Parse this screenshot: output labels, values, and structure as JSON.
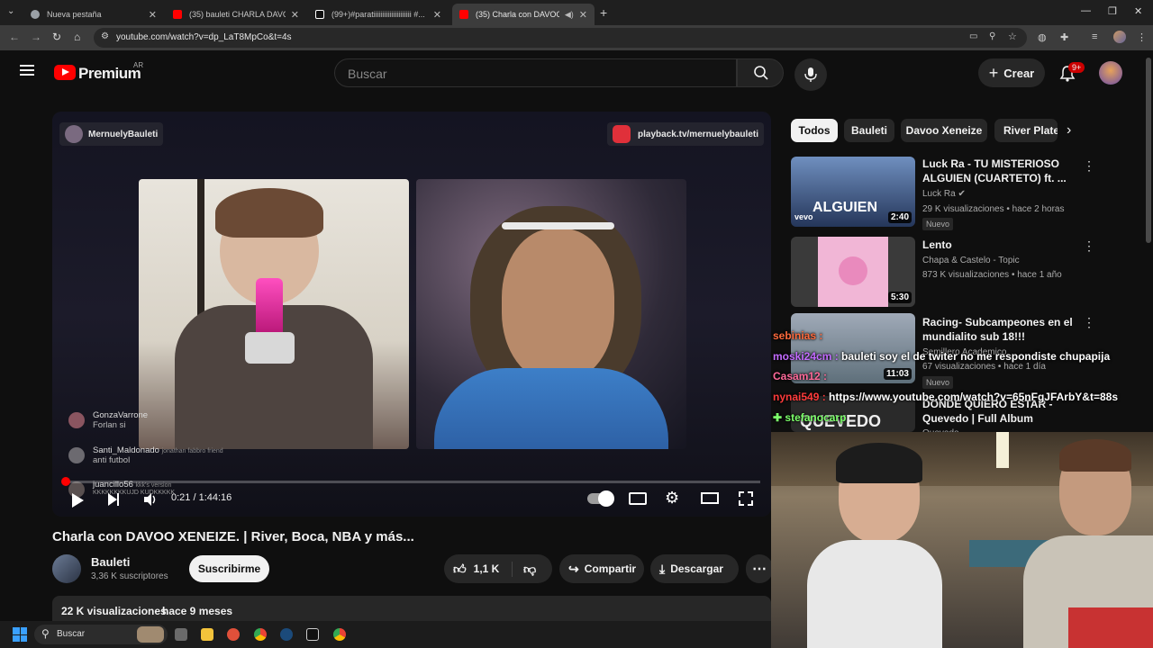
{
  "browser": {
    "tabs": [
      {
        "title": "Nueva pestaña",
        "active": false,
        "favicon_color": "#9aa0a6"
      },
      {
        "title": "(35) bauleti CHARLA DAVO XE...",
        "active": false,
        "favicon_color": "#ff0000"
      },
      {
        "title": "(99+)#paratiiiiiiiiiiiiiiiiiiiii #...",
        "active": false,
        "favicon_color": "#ffffff"
      },
      {
        "title": "(35) Charla con DAVOO XE...",
        "active": true,
        "favicon_color": "#ff0000"
      }
    ],
    "new_tab": "+",
    "url": "youtube.com/watch?v=dp_LaT8MpCo&t=4s"
  },
  "header": {
    "logo_text": "Premium",
    "region": "AR",
    "search_placeholder": "Buscar",
    "create_label": "Crear",
    "notifications_badge": "9+"
  },
  "player": {
    "channel_badge": "MernuelyBauleti",
    "playback_badge": "playback.tv/mernuelybauleti",
    "time": "0:21 / 1:44:16",
    "progress_fraction": 0.0034,
    "chat": [
      {
        "user": "GonzaVarrone",
        "msg": "Forlan si"
      },
      {
        "user": "Santi_Maldonado",
        "tag": "jonathan fabbro friend",
        "msg": "anti futbol"
      },
      {
        "user": "juancillo56",
        "tag": "kkk's version",
        "msg": "KKKKKKKKUJD KUDKKKKK"
      }
    ]
  },
  "video": {
    "title": "Charla con DAVOO XENEIZE. | River, Boca, NBA y más...",
    "channel": "Bauleti",
    "subscribers": "3,36 K suscriptores",
    "subscribe_label": "Suscribirme",
    "likes": "1,1 K",
    "share_label": "Compartir",
    "download_label": "Descargar",
    "views": "22 K visualizaciones",
    "age": "hace 9 meses"
  },
  "chips": [
    "Todos",
    "Bauleti",
    "Davoo Xeneize",
    "River Plate"
  ],
  "recommendations": [
    {
      "title": "Luck Ra - TU MISTERIOSO ALGUIEN (CUARTETO) ft. ...",
      "channel": "Luck Ra",
      "meta": "29 K visualizaciones • hace 2 horas",
      "badge": "Nuevo",
      "duration": "2:40",
      "thumb_text": "ALGUIEN",
      "thumb_brand": "vevo"
    },
    {
      "title": "Lento",
      "channel": "Chapa & Castelo - Topic",
      "meta": "873 K visualizaciones • hace 1 año",
      "badge": "",
      "duration": "5:30"
    },
    {
      "title": "Racing- Subcampeones en el mundialito sub 18!!!",
      "channel": "Semillero Academico",
      "meta": "67 visualizaciones • hace 1 día",
      "badge": "Nuevo",
      "duration": "11:03"
    },
    {
      "title": "DONDE QUIERO ESTAR - Quevedo | Full Album",
      "channel": "Quevedo",
      "meta": "",
      "badge": "",
      "duration": "",
      "thumb_text": "QUEVEDO"
    }
  ],
  "stream_overlay": [
    {
      "user": "sebinias :",
      "msg": "",
      "color": "#ff6a3c"
    },
    {
      "user": "moski24cm :",
      "msg": "bauleti soy el de twiter no me respondiste chupapija",
      "color": "#c36bff"
    },
    {
      "user": "Casam12 :",
      "msg": "",
      "color": "#ff6a9a"
    },
    {
      "user": "nynai549 :",
      "msg": "https://www.youtube.com/watch?v=65nFgJFArbY&t=88s",
      "color": "#ff3b3b"
    },
    {
      "user": "stefanocarp",
      "msg": "",
      "color": "#7cff6a"
    }
  ],
  "taskbar": {
    "search_label": "Buscar"
  },
  "colors": {
    "accent_red": "#ff0000",
    "chip_active_bg": "#f1f1f1"
  }
}
